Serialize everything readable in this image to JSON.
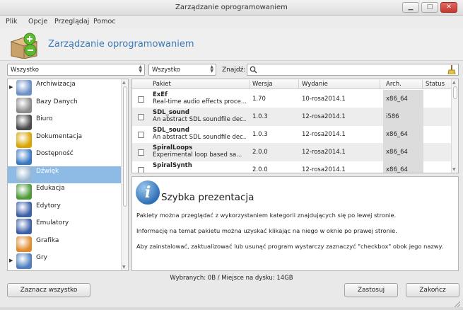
{
  "window": {
    "title": "Zarządzanie oprogramowaniem",
    "controls": [
      "minimize",
      "maximize",
      "close"
    ]
  },
  "menu": [
    "Plik",
    "Opcje",
    "Przeglądaj",
    "Pomoc"
  ],
  "banner": {
    "title": "Zarządzanie oprogramowaniem",
    "icon": "package-manager-icon"
  },
  "filters": {
    "group_value": "Wszystko",
    "status_value": "Wszystko",
    "find_label": "Znajdź:",
    "search_value": ""
  },
  "categories": [
    {
      "label": "Archiwizacja",
      "icon": "archive-icon",
      "color": "#6b8fc7",
      "expandable": true
    },
    {
      "label": "Bazy Danych",
      "icon": "database-icon",
      "color": "#8a8a8a",
      "expandable": false
    },
    {
      "label": "Biuro",
      "icon": "office-icon",
      "color": "#4a4a4a",
      "expandable": false
    },
    {
      "label": "Dokumentacja",
      "icon": "documentation-icon",
      "color": "#d9a400",
      "expandable": false
    },
    {
      "label": "Dostępność",
      "icon": "accessibility-icon",
      "color": "#3a78c4",
      "expandable": false
    },
    {
      "label": "Dźwięk",
      "icon": "sound-icon",
      "color": "#9ab6d0",
      "expandable": false,
      "selected": true
    },
    {
      "label": "Edukacja",
      "icon": "education-icon",
      "color": "#4e9a3a",
      "expandable": false
    },
    {
      "label": "Edytory",
      "icon": "editors-icon",
      "color": "#3b5fa8",
      "expandable": false
    },
    {
      "label": "Emulatory",
      "icon": "emulators-icon",
      "color": "#3b5fa8",
      "expandable": false
    },
    {
      "label": "Grafika",
      "icon": "graphics-icon",
      "color": "#e08a2c",
      "expandable": false
    },
    {
      "label": "Gry",
      "icon": "games-icon",
      "color": "#4f7fbf",
      "expandable": true
    }
  ],
  "table": {
    "headers": [
      "Pakiet",
      "Wersja",
      "Wydanie",
      "Arch.",
      "Status"
    ],
    "rows": [
      {
        "name": "ExEf",
        "desc": "Real-time audio effects proce...",
        "version": "1.70",
        "release": "10-rosa2014.1",
        "arch": "x86_64"
      },
      {
        "name": "SDL_sound",
        "desc": "An abstract SDL soundfile dec...",
        "version": "1.0.3",
        "release": "12-rosa2014.1",
        "arch": "i586"
      },
      {
        "name": "SDL_sound",
        "desc": "An abstract SDL soundfile dec...",
        "version": "1.0.3",
        "release": "12-rosa2014.1",
        "arch": "x86_64"
      },
      {
        "name": "SpiralLoops",
        "desc": "Experimental loop based sa...",
        "version": "2.0.0",
        "release": "12-rosa2014.1",
        "arch": "x86_64"
      },
      {
        "name": "SpiralSynth",
        "desc": "",
        "version": "2.0.0",
        "release": "12-rosa2014.1",
        "arch": "x86_64"
      }
    ]
  },
  "info": {
    "title": "Szybka prezentacja",
    "lines": [
      "Pakiety można przeglądać z wykorzystaniem kategorii znajdujących się po lewej stronie.",
      "Informację na temat pakietu można uzyskać klikając na niego w oknie po prawej stronie.",
      "Aby zainstalować, zaktualizować lub usunąć program wystarczy zaznaczyć \"checkbox\" obok jego nazwy."
    ]
  },
  "status": "Wybranych: 0B / Miejsce na dysku: 14GB",
  "buttons": {
    "select_all": "Zaznacz wszystko",
    "apply": "Zastosuj",
    "finish": "Zakończ"
  }
}
